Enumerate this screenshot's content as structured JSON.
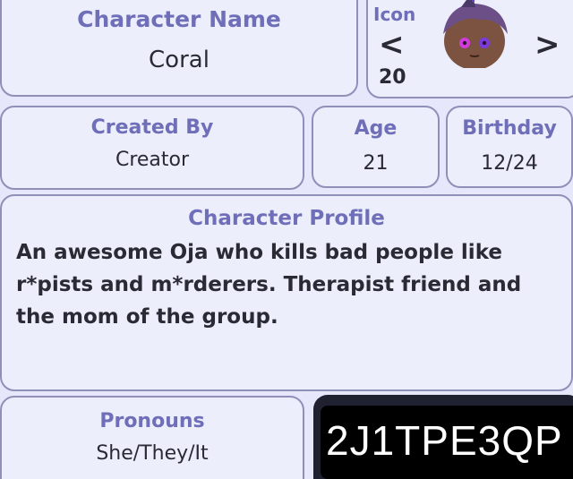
{
  "name": {
    "label": "Character Name",
    "value": "Coral"
  },
  "icon": {
    "label": "Icon",
    "prev": "<",
    "next": ">",
    "number": "20"
  },
  "created_by": {
    "label": "Created By",
    "value": "Creator"
  },
  "age": {
    "label": "Age",
    "value": "21"
  },
  "birthday": {
    "label": "Birthday",
    "value": "12/24"
  },
  "profile": {
    "label": "Character Profile",
    "text": "An awesome Oja who kills bad people like r*pists and m*rderers. Therapist friend and the mom of the group."
  },
  "pronouns": {
    "label": "Pronouns",
    "value": "She/They/It"
  },
  "code": {
    "value": "2J1TPE3QP"
  },
  "colors": {
    "label": "#6f6eb8",
    "background": "#e6e7fb",
    "border": "#8f90b8"
  }
}
